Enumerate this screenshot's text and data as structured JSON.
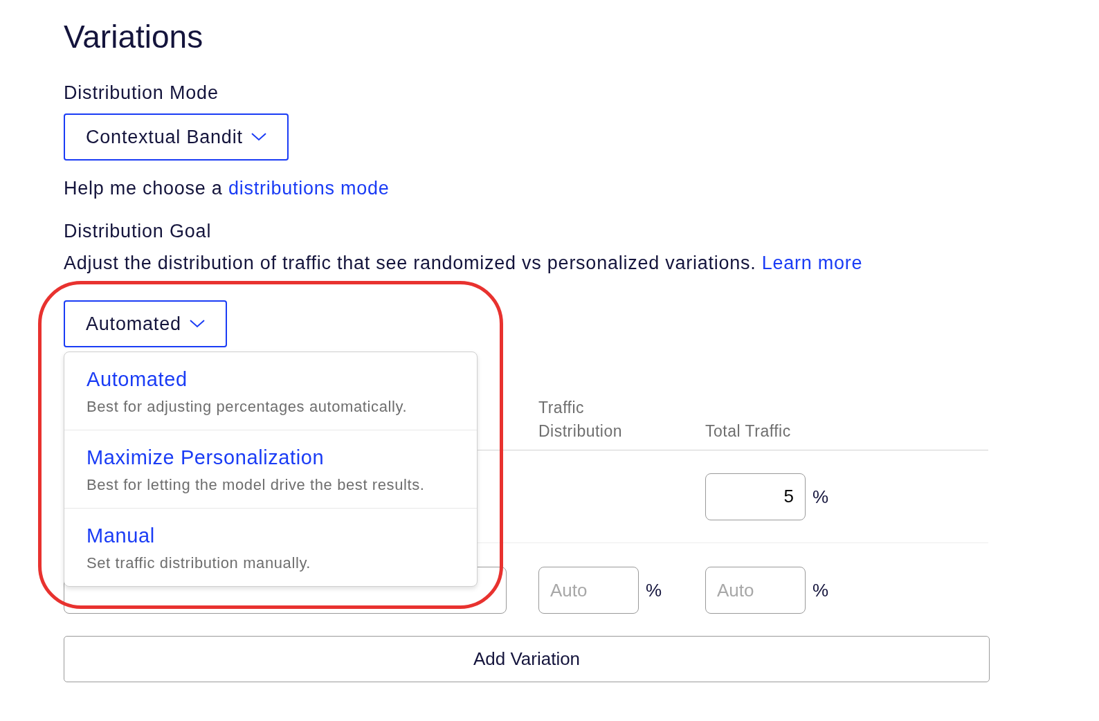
{
  "page": {
    "title": "Variations"
  },
  "distribution_mode": {
    "label": "Distribution Mode",
    "value": "Contextual Bandit"
  },
  "help": {
    "text": "Help me choose a",
    "link": "distributions mode"
  },
  "distribution_goal": {
    "label": "Distribution Goal",
    "description": "Adjust the distribution of traffic that see randomized vs personalized variations.",
    "link": "Learn more",
    "value": "Automated",
    "expanded": true,
    "highlighted": true,
    "options": [
      {
        "title": "Automated",
        "description": "Best for adjusting percentages automatically."
      },
      {
        "title": "Maximize Personalization",
        "description": "Best for letting the model drive the best results."
      },
      {
        "title": "Manual",
        "description": "Set traffic distribution manually."
      }
    ]
  },
  "table": {
    "columns": [
      "Traffic Distribution",
      "Total Traffic"
    ],
    "rows": [
      {
        "kind": "total",
        "total_traffic": "5",
        "total_unit": "%"
      },
      {
        "kind": "variation",
        "traffic_placeholder": "Auto",
        "traffic_unit": "%",
        "total_placeholder": "Auto",
        "total_unit": "%"
      }
    ]
  },
  "add_button": "Add Variation"
}
